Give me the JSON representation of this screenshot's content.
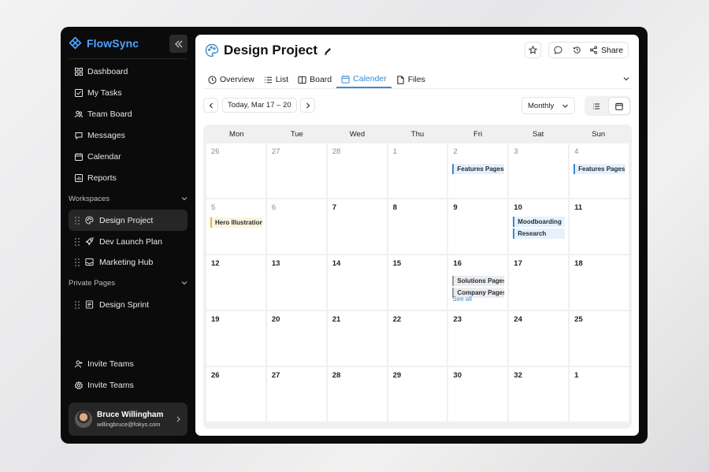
{
  "app": {
    "name": "FlowSync",
    "brand_color": "#4da3ff"
  },
  "sidebar": {
    "nav": [
      {
        "label": "Dashboard",
        "icon": "grid-icon"
      },
      {
        "label": "My Tasks",
        "icon": "task-icon"
      },
      {
        "label": "Team Board",
        "icon": "team-icon"
      },
      {
        "label": "Messages",
        "icon": "message-icon"
      },
      {
        "label": "Calendar",
        "icon": "calendar-icon"
      },
      {
        "label": "Reports",
        "icon": "bar-chart-icon"
      }
    ],
    "workspaces_label": "Workspaces",
    "workspaces": [
      {
        "label": "Design Project",
        "icon": "palette-icon",
        "active": true
      },
      {
        "label": "Dev Launch Plan",
        "icon": "rocket-icon",
        "active": false
      },
      {
        "label": "Marketing Hub",
        "icon": "inbox-icon",
        "active": false
      }
    ],
    "private_label": "Private Pages",
    "private_pages": [
      {
        "label": "Design Sprint",
        "icon": "document-icon"
      }
    ],
    "bottom": [
      {
        "label": "Invite Teams",
        "icon": "user-plus-icon"
      },
      {
        "label": "Invite Teams",
        "icon": "settings-icon"
      }
    ],
    "user": {
      "name": "Bruce Willingham",
      "email": "willingbruce@fokys.com"
    }
  },
  "main": {
    "title": "Design Project",
    "share_label": "Share",
    "tabs": [
      {
        "label": "Overview",
        "icon": "clock-icon",
        "active": false
      },
      {
        "label": "List",
        "icon": "list-icon",
        "active": false
      },
      {
        "label": "Board",
        "icon": "board-icon",
        "active": false
      },
      {
        "label": "Calender",
        "icon": "calendar-icon",
        "active": true
      },
      {
        "label": "Files",
        "icon": "file-icon",
        "active": false
      }
    ],
    "date_range": "Today, Mar 17 – 20",
    "view_select": "Monthly",
    "accent": "#3b8bd0"
  },
  "calendar": {
    "weekdays": [
      "Mon",
      "Tue",
      "Wed",
      "Thu",
      "Fri",
      "Sat",
      "Sun"
    ],
    "weeks": [
      [
        {
          "day": "26",
          "muted": true,
          "events": []
        },
        {
          "day": "27",
          "muted": true,
          "events": []
        },
        {
          "day": "28",
          "muted": true,
          "events": []
        },
        {
          "day": "1",
          "muted": true,
          "events": []
        },
        {
          "day": "2",
          "muted": true,
          "events": [
            {
              "title": "Features Pages",
              "color": "blue"
            }
          ]
        },
        {
          "day": "3",
          "muted": true,
          "events": []
        },
        {
          "day": "4",
          "muted": true,
          "events": [
            {
              "title": "Features Pages",
              "color": "blue"
            }
          ]
        }
      ],
      [
        {
          "day": "5",
          "muted": true,
          "events": [
            {
              "title": "Hero Illustration",
              "color": "yellow"
            }
          ]
        },
        {
          "day": "6",
          "muted": true,
          "events": []
        },
        {
          "day": "7",
          "muted": false,
          "events": []
        },
        {
          "day": "8",
          "muted": false,
          "events": []
        },
        {
          "day": "9",
          "muted": false,
          "events": []
        },
        {
          "day": "10",
          "muted": false,
          "events": [
            {
              "title": "Moodboarding",
              "color": "blue"
            },
            {
              "title": "Research",
              "color": "blue"
            }
          ]
        },
        {
          "day": "11",
          "muted": false,
          "events": []
        }
      ],
      [
        {
          "day": "12",
          "muted": false,
          "events": []
        },
        {
          "day": "13",
          "muted": false,
          "events": []
        },
        {
          "day": "14",
          "muted": false,
          "events": []
        },
        {
          "day": "15",
          "muted": false,
          "events": []
        },
        {
          "day": "16",
          "muted": false,
          "events": [
            {
              "title": "Solutions Pages",
              "color": "gray"
            },
            {
              "title": "Company Pages",
              "color": "gray"
            }
          ],
          "see_all": "See all"
        },
        {
          "day": "17",
          "muted": false,
          "events": []
        },
        {
          "day": "18",
          "muted": false,
          "events": []
        }
      ],
      [
        {
          "day": "19",
          "muted": false,
          "events": []
        },
        {
          "day": "20",
          "muted": false,
          "events": []
        },
        {
          "day": "21",
          "muted": false,
          "events": []
        },
        {
          "day": "22",
          "muted": false,
          "events": []
        },
        {
          "day": "23",
          "muted": false,
          "events": []
        },
        {
          "day": "24",
          "muted": false,
          "events": []
        },
        {
          "day": "25",
          "muted": false,
          "events": []
        }
      ],
      [
        {
          "day": "26",
          "muted": false,
          "events": []
        },
        {
          "day": "27",
          "muted": false,
          "events": []
        },
        {
          "day": "28",
          "muted": false,
          "events": []
        },
        {
          "day": "29",
          "muted": false,
          "events": []
        },
        {
          "day": "30",
          "muted": false,
          "events": []
        },
        {
          "day": "32",
          "muted": false,
          "events": []
        },
        {
          "day": "1",
          "muted": false,
          "events": []
        }
      ]
    ]
  }
}
